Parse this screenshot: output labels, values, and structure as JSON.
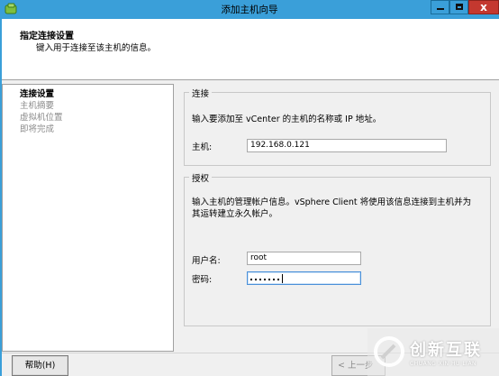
{
  "window": {
    "title": "添加主机向导",
    "close_glyph": "x"
  },
  "header": {
    "title": "指定连接设置",
    "subtitle": "键入用于连接至该主机的信息。"
  },
  "nav": {
    "items": [
      {
        "label": "连接设置",
        "active": true
      },
      {
        "label": "主机摘要",
        "active": false
      },
      {
        "label": "虚拟机位置",
        "active": false
      },
      {
        "label": "即将完成",
        "active": false
      }
    ]
  },
  "connection": {
    "legend": "连接",
    "description": "输入要添加至 vCenter 的主机的名称或 IP 地址。",
    "host_label": "主机:",
    "host_value": "192.168.0.121"
  },
  "authorization": {
    "legend": "授权",
    "description_line1": "输入主机的管理帐户信息。vSphere Client 将使用该信息连接到主机并为",
    "description_line2": "其运转建立永久帐户。",
    "username_label": "用户名:",
    "username_value": "root",
    "password_label": "密码:",
    "password_masked": "*******"
  },
  "buttons": {
    "help": "帮助(H)",
    "back": "< 上一步"
  },
  "watermark": {
    "text": "创新互联",
    "subtext": "CHUANG XIN HU LIAN"
  }
}
